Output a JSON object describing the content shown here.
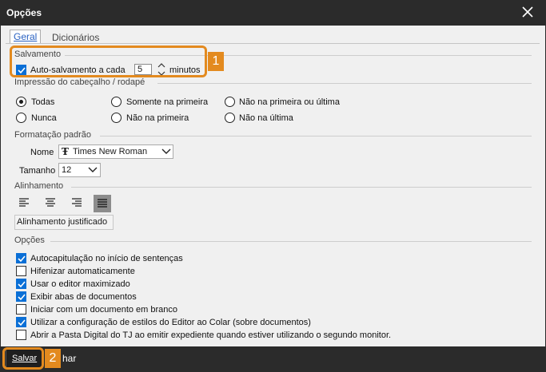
{
  "window": {
    "title": "Opções"
  },
  "tabs": [
    {
      "label": "Geral"
    },
    {
      "label": "Dicionários"
    }
  ],
  "salvamento": {
    "heading": "Salvamento",
    "autosave_label": "Auto-salvamento a cada",
    "autosave_checked": true,
    "interval_value": "5",
    "unit": "minutos"
  },
  "header_print": {
    "heading": "Impressão do cabeçalho / rodapé",
    "options": [
      {
        "label": "Todas",
        "selected": true
      },
      {
        "label": "Somente na primeira",
        "selected": false
      },
      {
        "label": "Não na primeira ou última",
        "selected": false
      },
      {
        "label": "Nunca",
        "selected": false
      },
      {
        "label": "Não na primeira",
        "selected": false
      },
      {
        "label": "Não na última",
        "selected": false
      }
    ]
  },
  "formatting": {
    "heading": "Formatação padrão",
    "name_label": "Nome",
    "font_name": "Times New Roman",
    "size_label": "Tamanho",
    "font_size": "12"
  },
  "alignment": {
    "heading": "Alinhamento",
    "buttons": [
      "align-left-icon",
      "align-center-icon",
      "align-right-icon",
      "align-justify-icon"
    ],
    "selected": "align-justify-icon",
    "tooltip": "Alinhamento justificado"
  },
  "options": {
    "heading": "Opções",
    "items": [
      {
        "label": "Autocapitulação no início de sentenças",
        "checked": true
      },
      {
        "label": "Hifenizar automaticamente",
        "checked": false
      },
      {
        "label": "Usar o editor maximizado",
        "checked": true
      },
      {
        "label": "Exibir abas de documentos",
        "checked": true
      },
      {
        "label": "Iniciar com um documento em branco",
        "checked": false
      },
      {
        "label": "Utilizar a configuração de estilos do Editor ao Colar (sobre documentos)",
        "checked": true
      },
      {
        "label": "Abrir a Pasta Digital do TJ ao emitir expediente quando estiver utilizando o segundo monitor.",
        "checked": false
      }
    ]
  },
  "footer": {
    "save_label": "Salvar",
    "cancel_label_visible": "har"
  },
  "callouts": [
    {
      "number": "1"
    },
    {
      "number": "2"
    }
  ],
  "colors": {
    "accent": "#e38a1f",
    "check": "#0a6fd6",
    "titlebar": "#2b2b2b"
  }
}
